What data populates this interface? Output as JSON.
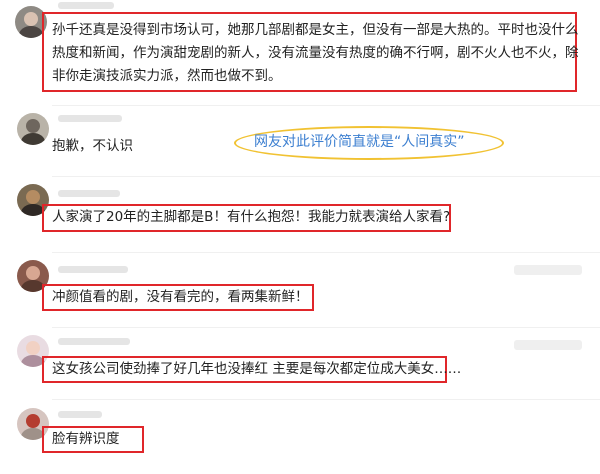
{
  "comments": [
    {
      "lines": [
        "孙千还真是没得到市场认可，她那几部剧都是女主，但没有一部是大热的。平时也没什么",
        "热度和新闻，作为演甜宠剧的新人，没有流量没有热度的确不行啊，剧不火人也不火，除",
        "非你走演技派实力派，然而也做不到。"
      ]
    },
    {
      "lines": [
        "抱歉，不认识"
      ]
    },
    {
      "lines": [
        "人家演了20年的主脚都是B！有什么抱怨！我能力就表演给人家看?"
      ]
    },
    {
      "lines": [
        "冲颜值看的剧，没有看完的，看两集新鲜！"
      ]
    },
    {
      "lines": [
        "这女孩公司使劲捧了好几年也没捧红 主要是每次都定位成大美女……"
      ]
    },
    {
      "lines": [
        "脸有辨识度"
      ]
    }
  ],
  "annotation": {
    "text": "网友对此评价简直就是“人间真实”"
  },
  "colors": {
    "highlight_box": "#e0262a",
    "annotation_ellipse": "#f1c232",
    "annotation_text": "#3c7fd0"
  }
}
